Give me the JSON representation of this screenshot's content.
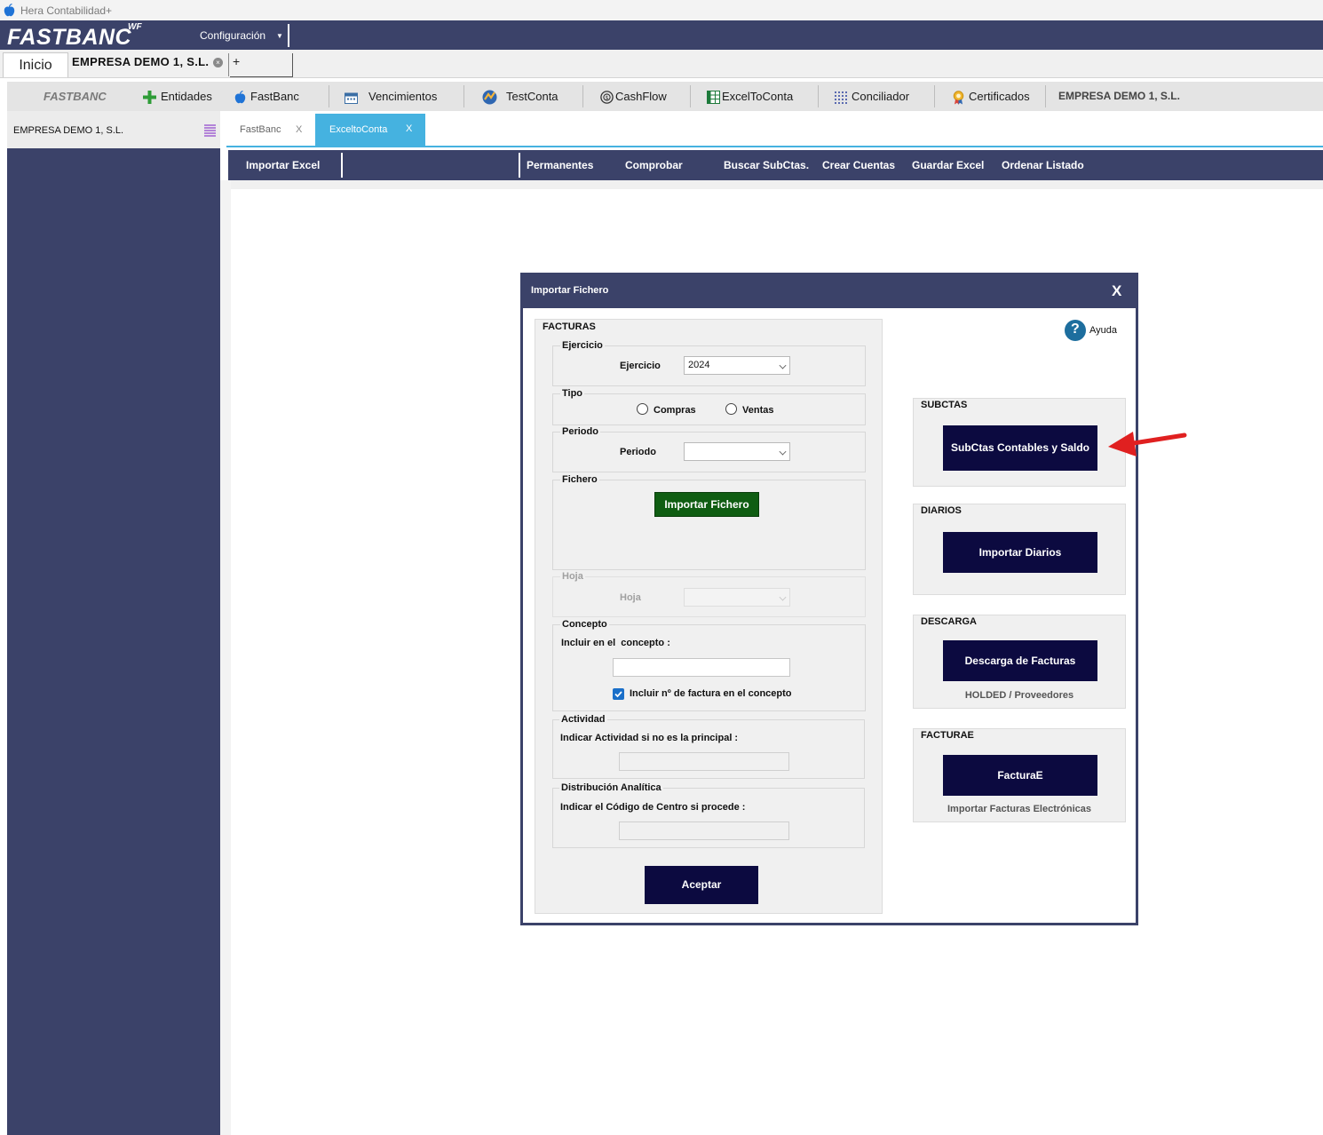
{
  "window": {
    "title": "Hera Contabilidad+"
  },
  "header": {
    "brand": "FASTBANC",
    "brand_sup": "WF",
    "config_menu": "Configuración"
  },
  "tabs": {
    "home": "Inicio",
    "company": "EMPRESA DEMO 1, S.L.",
    "add": "+"
  },
  "navbar": {
    "brand": "FASTBANC",
    "items": [
      "Entidades",
      "FastBanc",
      "Vencimientos",
      "TestConta",
      "CashFlow",
      "ExcelToConta",
      "Conciliador",
      "Certificados"
    ],
    "company": "EMPRESA DEMO 1, S.L."
  },
  "sidebar": {
    "title": "EMPRESA DEMO 1, S.L."
  },
  "inner_tabs": [
    {
      "label": "FastBanc",
      "close": "X"
    },
    {
      "label": "ExceltoConta",
      "close": "X"
    }
  ],
  "toolbar": {
    "items": [
      "Importar Excel",
      "Permanentes",
      "Comprobar",
      "Buscar SubCtas.",
      "Crear Cuentas",
      "Guardar Excel",
      "Ordenar Listado"
    ]
  },
  "dialog": {
    "title": "Importar Fichero",
    "close": "X",
    "help": "Ayuda",
    "facturas": {
      "legend": "FACTURAS",
      "ejercicio": {
        "legend": "Ejercicio",
        "label": "Ejercicio",
        "value": "2024"
      },
      "tipo": {
        "legend": "Tipo",
        "options": [
          "Compras",
          "Ventas"
        ]
      },
      "periodo": {
        "legend": "Periodo",
        "label": "Periodo",
        "value": ""
      },
      "fichero": {
        "legend": "Fichero",
        "button": "Importar Fichero"
      },
      "hoja": {
        "legend": "Hoja",
        "label": "Hoja",
        "value": ""
      },
      "concepto": {
        "legend": "Concepto",
        "label": "Incluir en el  concepto :",
        "value": "",
        "checkbox_label": "Incluir nº de factura en el concepto",
        "checked": true
      },
      "actividad": {
        "legend": "Actividad",
        "label": "Indicar Actividad si no es la principal :",
        "value": ""
      },
      "analitica": {
        "legend": "Distribución Analítica",
        "label": "Indicar el Código de Centro si procede :",
        "value": ""
      },
      "accept": "Aceptar"
    },
    "subctas": {
      "legend": "SUBCTAS",
      "button": "SubCtas Contables y Saldo"
    },
    "diarios": {
      "legend": "DIARIOS",
      "button": "Importar Diarios"
    },
    "descarga": {
      "legend": "DESCARGA",
      "button": "Descarga de Facturas",
      "note": "HOLDED / Proveedores"
    },
    "facturae": {
      "legend": "FACTURAE",
      "button": "FacturaE",
      "note": "Importar Facturas Electrónicas"
    }
  },
  "colors": {
    "header": "#3b4269",
    "accent_tab": "#45b2e0",
    "dialog_button": "#0c0a40",
    "green_button": "#0f5d12",
    "arrow": "#e02020"
  }
}
